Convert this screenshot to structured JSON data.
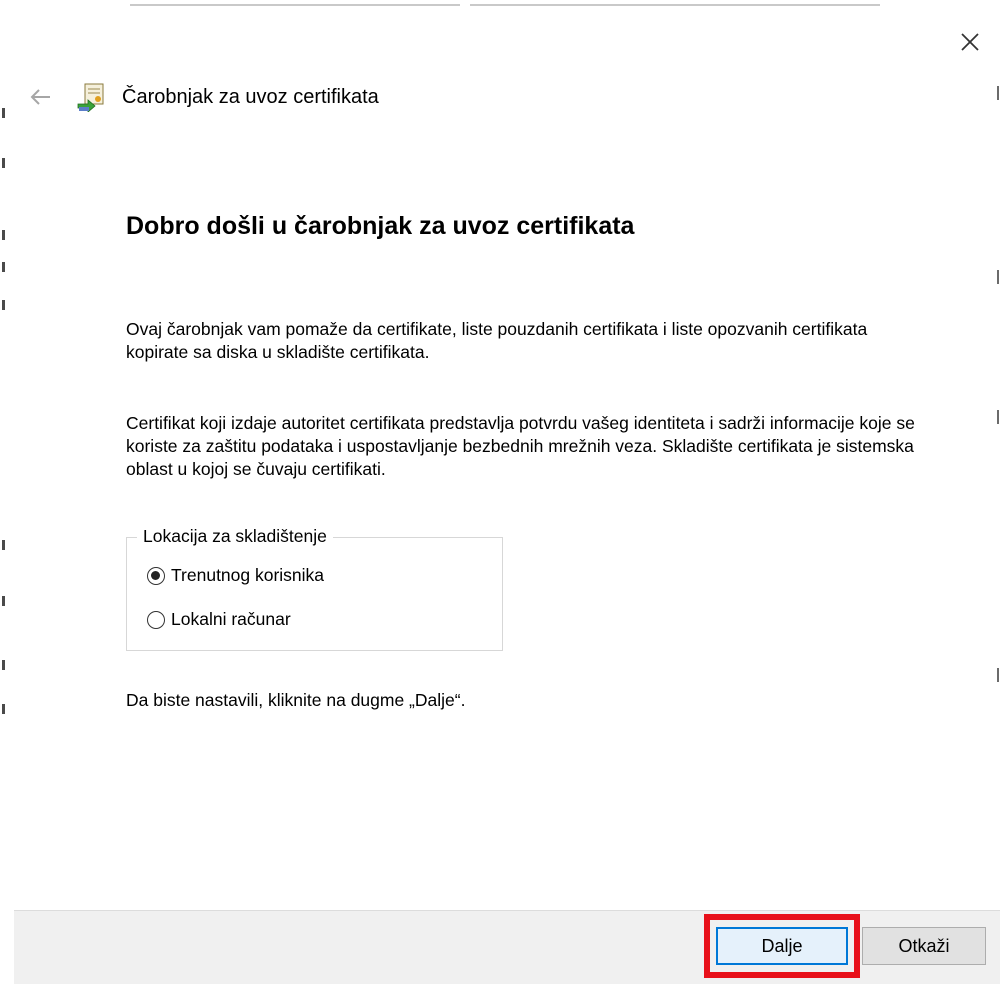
{
  "window": {
    "title": "Čarobnjak za uvoz certifikata",
    "close_icon": "close-icon",
    "back_icon": "back-arrow-icon",
    "app_icon": "certificate-wizard-icon"
  },
  "content": {
    "heading": "Dobro došli u čarobnjak za uvoz certifikata",
    "paragraph1": "Ovaj čarobnjak vam pomaže da certifikate, liste pouzdanih certifikata i liste opozvanih certifikata kopirate sa diska u skladište certifikata.",
    "paragraph2": "Certifikat koji izdaje autoritet certifikata predstavlja potvrdu vašeg identiteta i sadrži informacije koje se koriste za zaštitu podataka i uspostavljanje bezbednih mrežnih veza. Skladište certifikata je sistemska oblast u kojoj se čuvaju certifikati.",
    "store_location": {
      "legend": "Lokacija za skladištenje",
      "options": [
        {
          "label": "Trenutnog korisnika",
          "selected": true
        },
        {
          "label": "Lokalni računar",
          "selected": false
        }
      ]
    },
    "instruction": "Da biste nastavili, kliknite na dugme „Dalje“."
  },
  "footer": {
    "next_label": "Dalje",
    "cancel_label": "Otkaži"
  },
  "colors": {
    "accent": "#0078d7",
    "highlight": "#e8101a",
    "footer_bg": "#f0f0f0"
  }
}
